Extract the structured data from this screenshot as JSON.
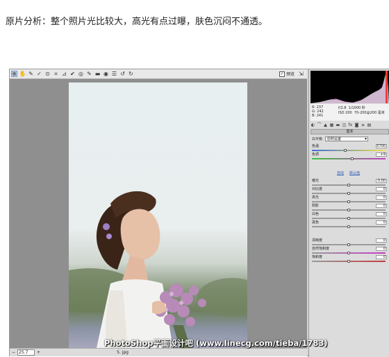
{
  "caption": "原片分析：整个照片光比较大，高光有点过曝，肤色沉闷不通透。",
  "toolbar": {
    "tools": [
      {
        "icon": "zoom-icon",
        "glyph": "⊕"
      },
      {
        "icon": "hand-icon",
        "glyph": "✋"
      },
      {
        "icon": "white-balance-icon",
        "glyph": "✎"
      },
      {
        "icon": "color-sampler-icon",
        "glyph": "✓"
      },
      {
        "icon": "targeted-adjustment-icon",
        "glyph": "⊙"
      },
      {
        "icon": "crop-icon",
        "glyph": "⌗"
      },
      {
        "icon": "straighten-icon",
        "glyph": "⊿"
      },
      {
        "icon": "spot-removal-icon",
        "glyph": "✔"
      },
      {
        "icon": "red-eye-icon",
        "glyph": "◎"
      },
      {
        "icon": "adjustment-brush-icon",
        "glyph": "✎"
      },
      {
        "icon": "graduated-filter-icon",
        "glyph": "▬"
      },
      {
        "icon": "radial-filter-icon",
        "glyph": "◉"
      },
      {
        "icon": "preferences-icon",
        "glyph": "☰"
      },
      {
        "icon": "rotate-left-icon",
        "glyph": "↺"
      },
      {
        "icon": "rotate-right-icon",
        "glyph": "↻"
      }
    ],
    "preview_label": "预览"
  },
  "readout": {
    "r": "R:  237",
    "g": "G:  242",
    "b": "B:  241",
    "aperture": "f/2.8",
    "shutter": "1/1000 秒",
    "iso": "ISO 200",
    "lens": "70-200@200 毫米"
  },
  "panel": {
    "section_title": "基本",
    "white_balance_label": "白平衡",
    "white_balance_value": "原照设置",
    "auto_label": "自动",
    "default_label": "默认值",
    "sliders": [
      {
        "label": "色温",
        "value": "5700",
        "level": 0.45
      },
      {
        "label": "色调",
        "value": "+9",
        "level": 0.55
      },
      {
        "label": "曝光",
        "value": "0.00",
        "level": 0.5
      },
      {
        "label": "对比度",
        "value": "0",
        "level": 0.5
      },
      {
        "label": "高光",
        "value": "0",
        "level": 0.5
      },
      {
        "label": "阴影",
        "value": "0",
        "level": 0.5
      },
      {
        "label": "白色",
        "value": "0",
        "level": 0.5
      },
      {
        "label": "黑色",
        "value": "0",
        "level": 0.5
      },
      {
        "label": "清晰度",
        "value": "0",
        "level": 0.5
      },
      {
        "label": "自然饱和度",
        "value": "0",
        "level": 0.5
      },
      {
        "label": "饱和度",
        "value": "0",
        "level": 0.5
      }
    ]
  },
  "status": {
    "zoom": "25.7",
    "info": "5. jpg"
  },
  "watermark": "PhotoShop平面设计吧 (www.linecg.com/tieba/1783)",
  "colors": {
    "canvas": "#8f8f8f",
    "panel": "#dcdcdc",
    "link": "#2a5bb8"
  }
}
